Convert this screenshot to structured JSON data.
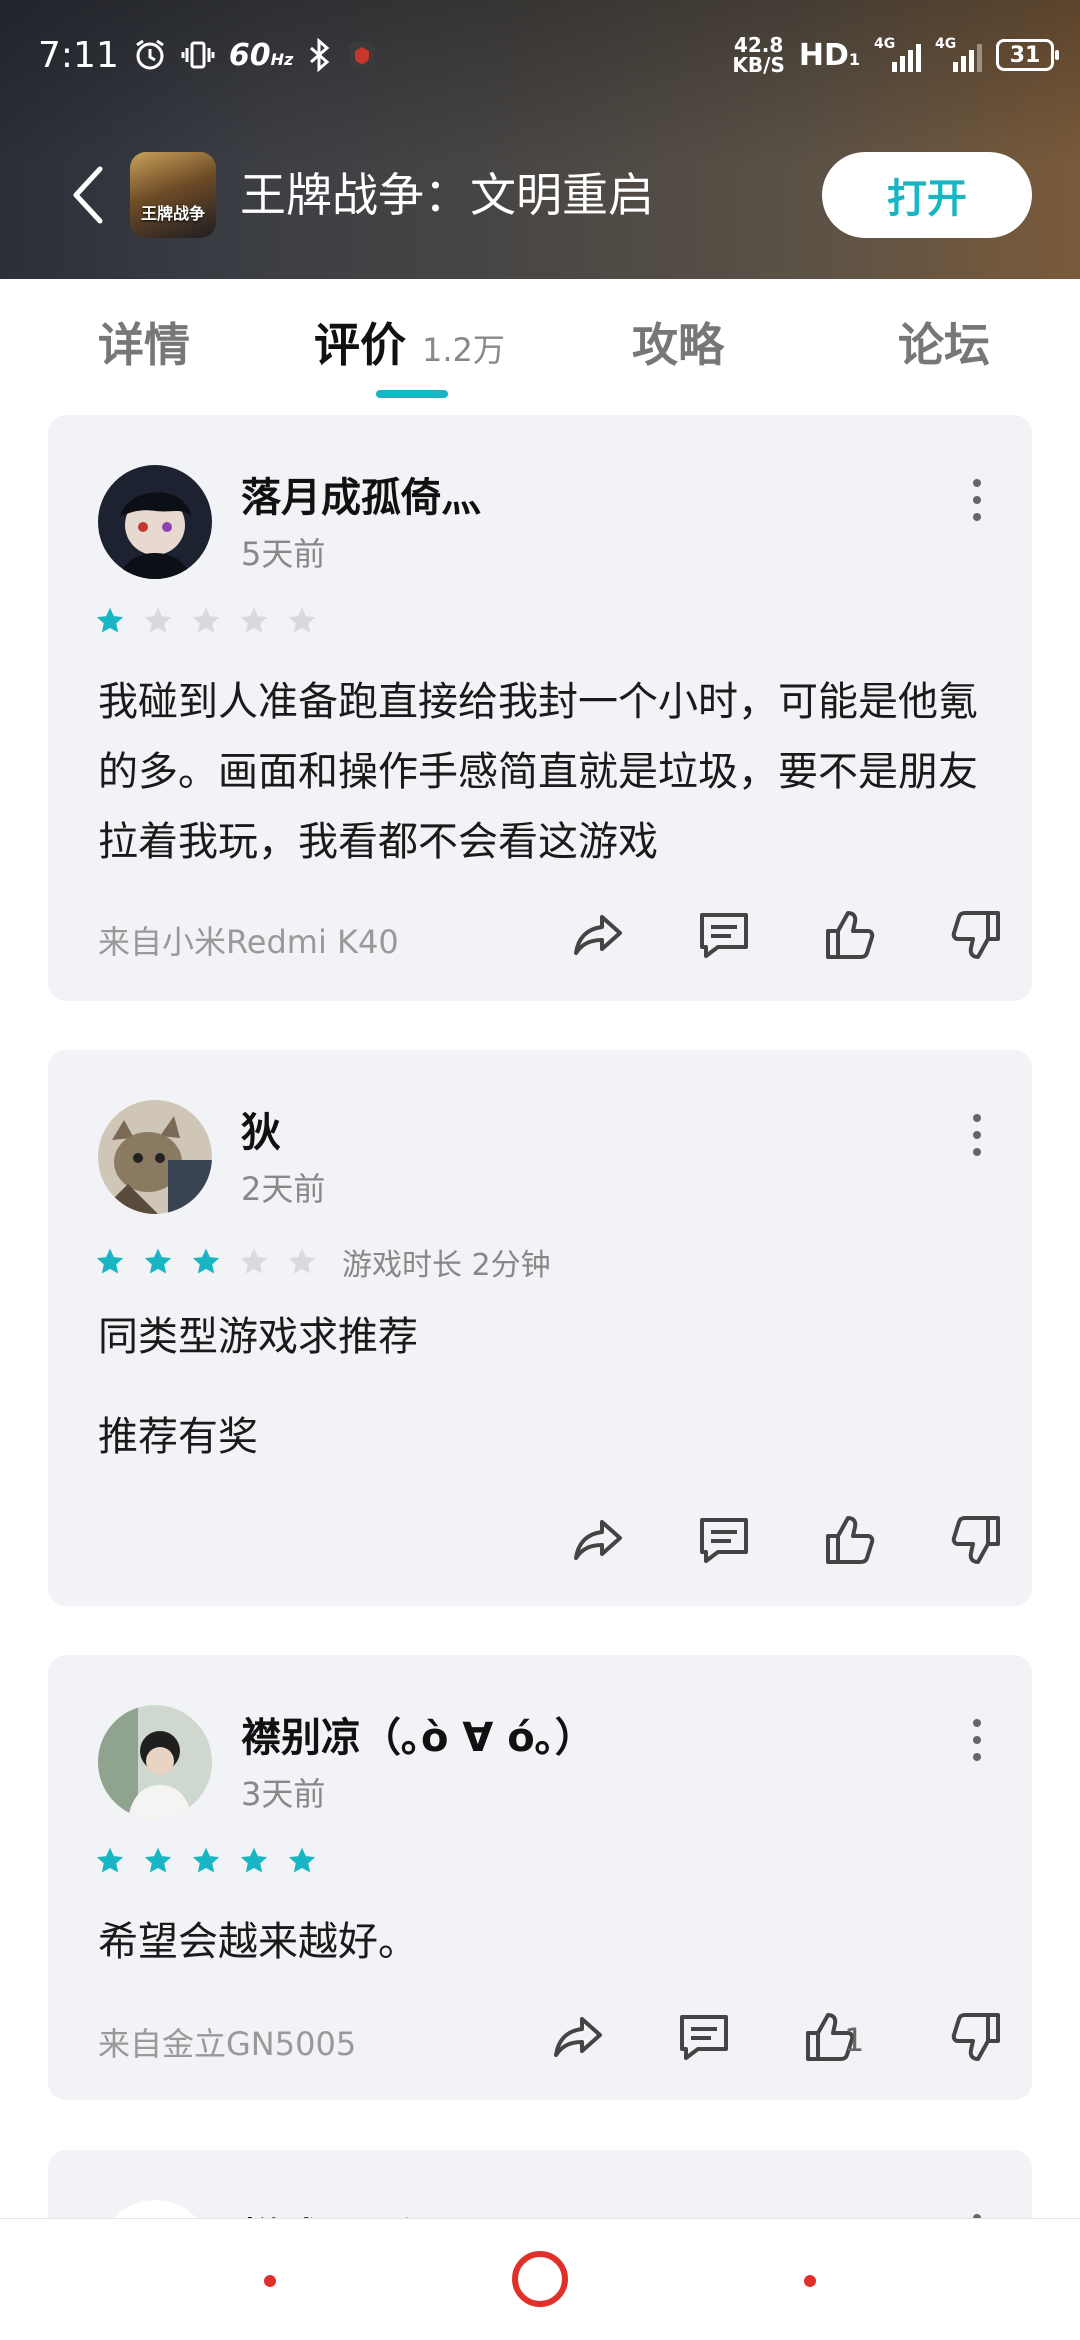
{
  "status_bar": {
    "time": "7:11",
    "refresh_rate": "60",
    "refresh_unit": "Hz",
    "speed_value": "42.8",
    "speed_unit": "KB/S",
    "hd": "HD",
    "hd_sub": "1",
    "sig1_label": "4G",
    "sig2_label": "4G",
    "battery": "31"
  },
  "app_bar": {
    "title": "王牌战争：文明重启",
    "icon_text": "王牌战争",
    "open_label": "打开"
  },
  "tabs": [
    {
      "label": "详情"
    },
    {
      "label": "评价",
      "count": "1.2万"
    },
    {
      "label": "攻略"
    },
    {
      "label": "论坛"
    }
  ],
  "reviews": [
    {
      "username": "落月成孤倚灬",
      "time": "5天前",
      "rating": 1,
      "content": "我碰到人准备跑直接给我封一个小时，可能是他氪的多。画面和操作手感简直就是垃圾，要不是朋友拉着我玩，我看都不会看这游戏",
      "device": "来自小米Redmi K40"
    },
    {
      "username": "狄",
      "time": "2天前",
      "rating": 3,
      "playtime": "游戏时长 2分钟",
      "paragraph1": "同类型游戏求推荐",
      "paragraph2": "推荐有奖"
    },
    {
      "username": "襟别凉（｡ò ∀ ó｡）",
      "time": "3天前",
      "rating": 5,
      "content": "希望会越来越好。",
      "device": "来自金立GN5005",
      "likes": "1"
    },
    {
      "username": "烂述…国汇"
    }
  ],
  "colors": {
    "accent": "#18b5c5",
    "star_empty": "#d9dadd",
    "card_bg": "#f2f3f6",
    "nav_red": "#e0302a"
  }
}
